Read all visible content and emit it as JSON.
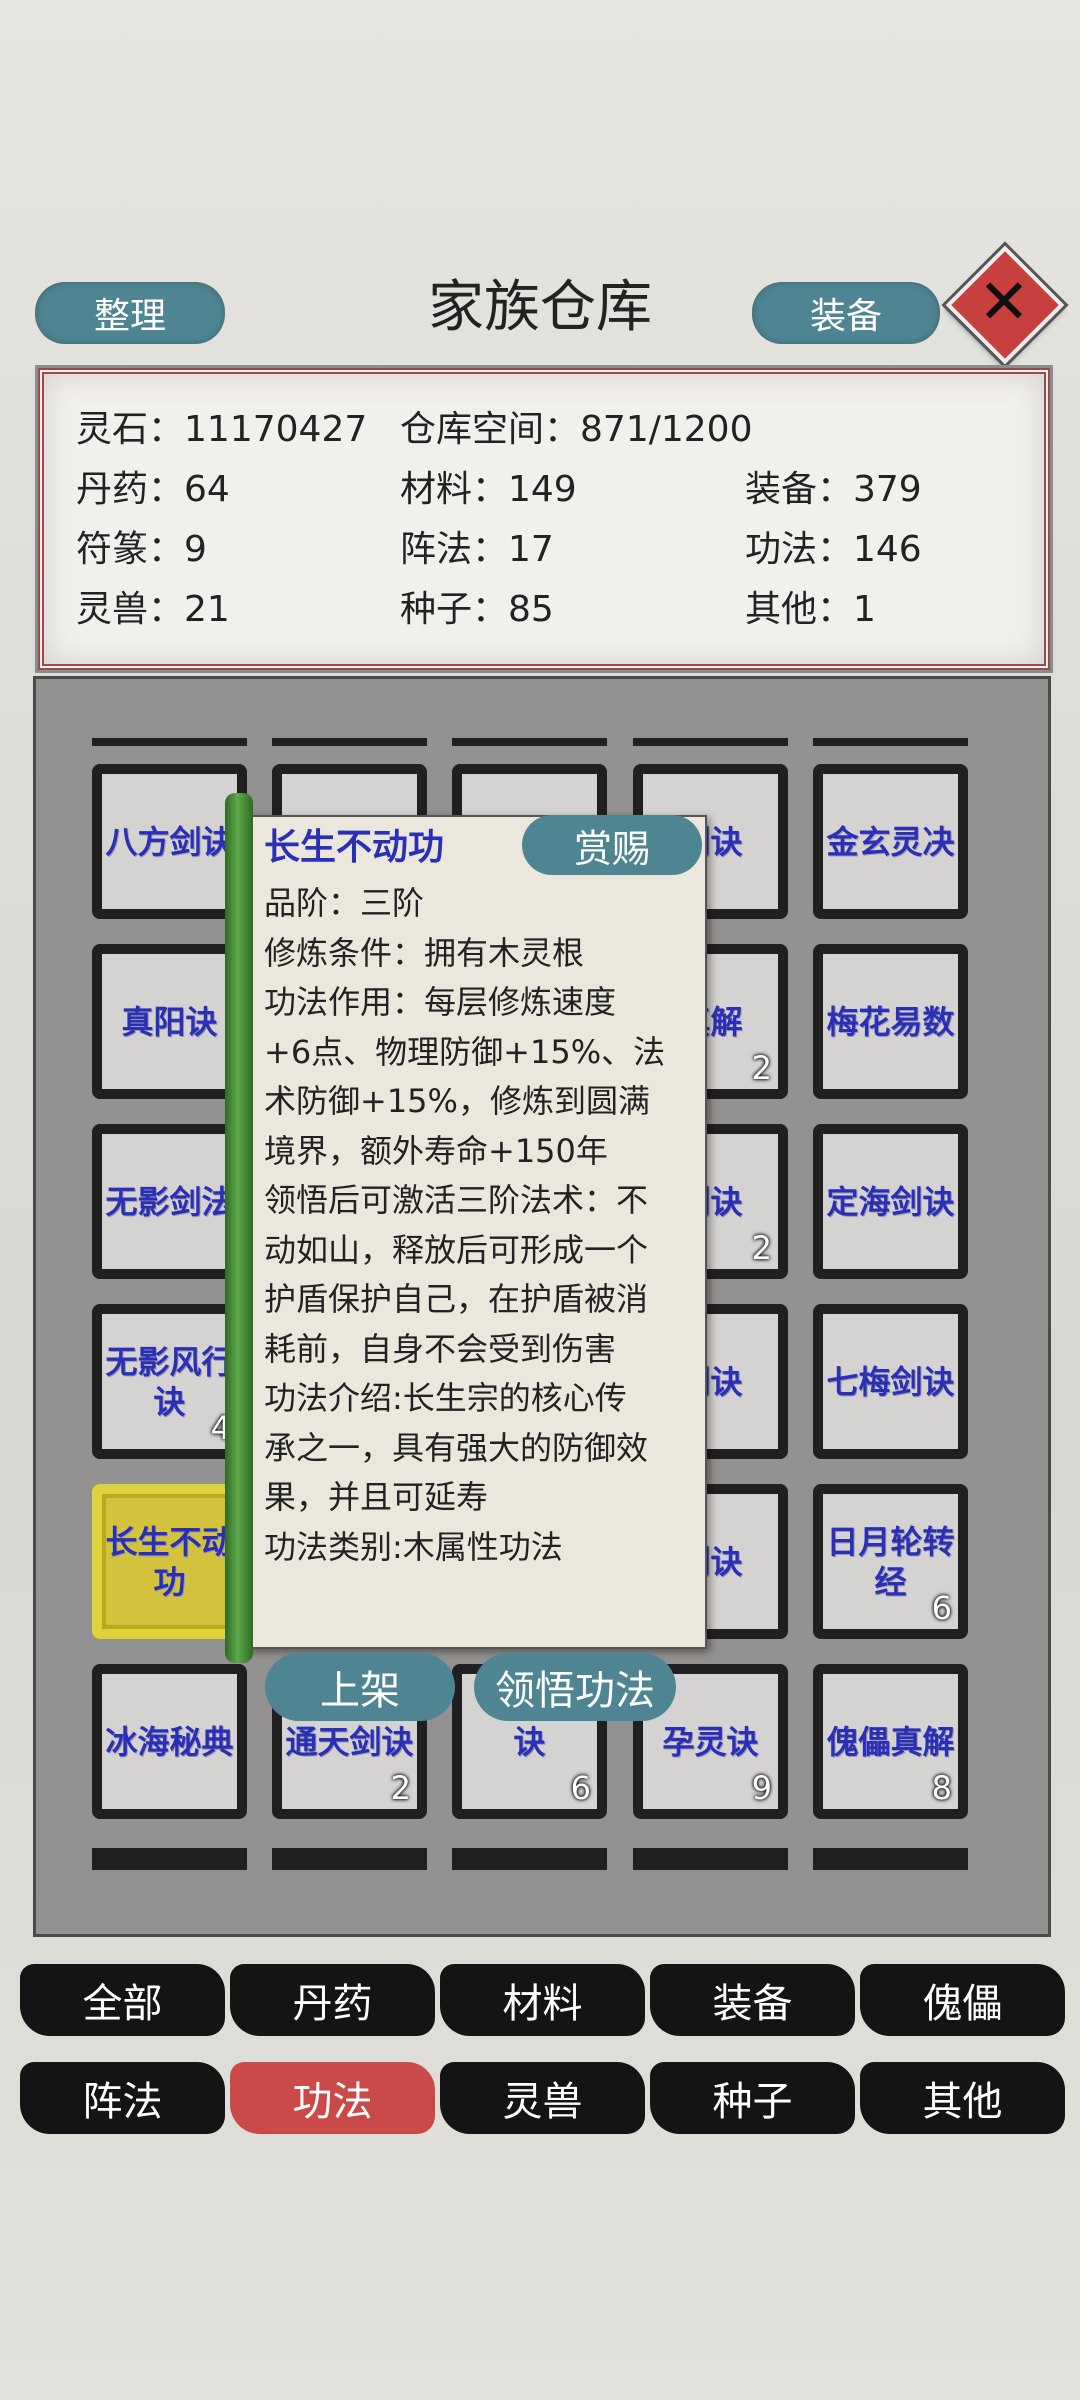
{
  "header": {
    "title": "家族仓库",
    "sort_label": "整理",
    "equip_label": "装备",
    "close_symbol": "✕"
  },
  "info": {
    "spirit_stone_label": "灵石：",
    "spirit_stone_value": "11170427",
    "storage_label": "仓库空间：",
    "storage_value": "871/1200",
    "rows": [
      [
        "丹药：64",
        "材料：149",
        "装备：379"
      ],
      [
        "符篆：9",
        "阵法：17",
        "功法：146"
      ],
      [
        "灵兽：21",
        "种子：85",
        "其他：1"
      ]
    ]
  },
  "grid": {
    "slots": [
      {
        "name": "八方剑诀",
        "count": ""
      },
      {
        "name": "",
        "count": ""
      },
      {
        "name": "",
        "count": ""
      },
      {
        "name": "剑诀",
        "count": ""
      },
      {
        "name": "金玄灵决",
        "count": ""
      },
      {
        "name": "真阳诀",
        "count": ""
      },
      {
        "name": "",
        "count": ""
      },
      {
        "name": "",
        "count": ""
      },
      {
        "name": "真解",
        "count": "2"
      },
      {
        "name": "梅花易数",
        "count": ""
      },
      {
        "name": "无影剑法",
        "count": ""
      },
      {
        "name": "",
        "count": ""
      },
      {
        "name": "",
        "count": ""
      },
      {
        "name": "剑诀",
        "count": "2"
      },
      {
        "name": "定海剑诀",
        "count": ""
      },
      {
        "name": "无影风行诀",
        "count": "4"
      },
      {
        "name": "",
        "count": ""
      },
      {
        "name": "",
        "count": ""
      },
      {
        "name": "剑诀",
        "count": ""
      },
      {
        "name": "七梅剑诀",
        "count": ""
      },
      {
        "name": "长生不动功",
        "count": ""
      },
      {
        "name": "",
        "count": ""
      },
      {
        "name": "",
        "count": ""
      },
      {
        "name": "剑诀",
        "count": ""
      },
      {
        "name": "日月轮转经",
        "count": "6"
      },
      {
        "name": "冰海秘典",
        "count": ""
      },
      {
        "name": "通天剑诀",
        "count": "2"
      },
      {
        "name": "诀",
        "count": "6"
      },
      {
        "name": "孕灵诀",
        "count": "9"
      },
      {
        "name": "傀儡真解",
        "count": "8"
      }
    ]
  },
  "tooltip": {
    "title": "长生不动功",
    "reward_label": "赏赐",
    "lines": [
      "品阶：三阶",
      "修炼条件：拥有木灵根",
      "功法作用：每层修炼速度",
      "+6点、物理防御+15%、法",
      "术防御+15%，修炼到圆满",
      "境界，额外寿命+150年",
      "领悟后可激活三阶法术：不",
      "动如山，释放后可形成一个",
      "护盾保护自己，在护盾被消",
      "耗前，自身不会受到伤害",
      "功法介绍:长生宗的核心传",
      "承之一，具有强大的防御效",
      "果，并且可延寿",
      "功法类别:木属性功法"
    ],
    "shelf_label": "上架",
    "learn_label": "领悟功法"
  },
  "tabs": [
    {
      "label": "全部",
      "active": false
    },
    {
      "label": "丹药",
      "active": false
    },
    {
      "label": "材料",
      "active": false
    },
    {
      "label": "装备",
      "active": false
    },
    {
      "label": "傀儡",
      "active": false
    },
    {
      "label": "阵法",
      "active": false
    },
    {
      "label": "功法",
      "active": true
    },
    {
      "label": "灵兽",
      "active": false
    },
    {
      "label": "种子",
      "active": false
    },
    {
      "label": "其他",
      "active": false
    }
  ],
  "colors": {
    "accent_teal": "#4f8593",
    "active_tab": "#c94a48",
    "item_name": "#2a2fb8",
    "selected_slot": "#d2c23c"
  }
}
